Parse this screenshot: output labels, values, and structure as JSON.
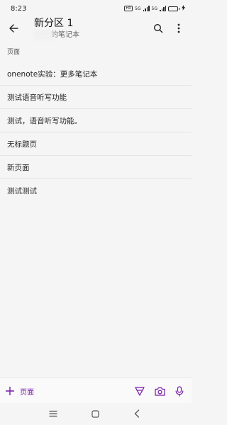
{
  "status_bar": {
    "time": "8:23",
    "hd_badge": "HD",
    "net_1": "5G",
    "net_2": "5G",
    "battery_percent": 80,
    "battery_label": "80"
  },
  "app_bar": {
    "title": "新分区 1",
    "subtitle": "的笔记本",
    "back_icon": "back-arrow-icon",
    "search_icon": "search-icon",
    "more_icon": "more-vertical-icon"
  },
  "section": {
    "header": "页面"
  },
  "pages": [
    "onenote实验：更多笔记本",
    "测试语音听写功能",
    "测试，语音听写功能。",
    "无标题页",
    "新页面",
    "测试测试"
  ],
  "bottom_toolbar": {
    "add_label": "页面",
    "accent_color": "#7719aa",
    "icons": [
      "pen-icon",
      "camera-icon",
      "microphone-icon"
    ]
  },
  "nav_bar": {
    "icons": [
      "menu-icon",
      "home-icon",
      "back-icon"
    ]
  }
}
